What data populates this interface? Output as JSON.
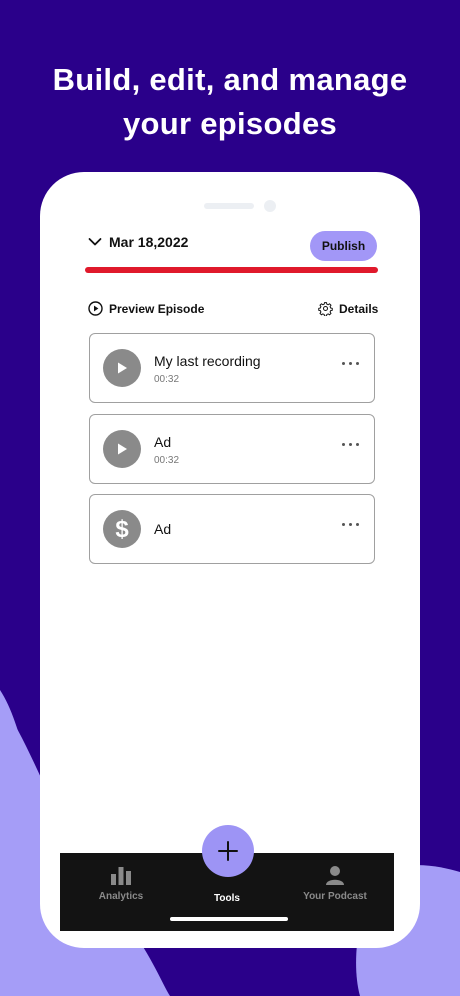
{
  "headline": {
    "line1": "Build, edit, and manage",
    "line2": "your episodes"
  },
  "episode": {
    "date": "Mar 18,2022",
    "publish_label": "Publish",
    "preview_label": "Preview Episode",
    "details_label": "Details"
  },
  "segments": [
    {
      "title": "My last recording",
      "duration": "00:32",
      "icon": "play-icon"
    },
    {
      "title": "Ad",
      "duration": "00:32",
      "icon": "play-icon"
    },
    {
      "title": "Ad",
      "duration": "",
      "icon": "dollar-icon"
    }
  ],
  "nav": {
    "analytics": "Analytics",
    "tools": "Tools",
    "your_podcast": "Your Podcast"
  },
  "colors": {
    "background": "#2a008a",
    "accent": "#a297f7",
    "progress": "#e0192b",
    "nav_bar": "#131313"
  }
}
